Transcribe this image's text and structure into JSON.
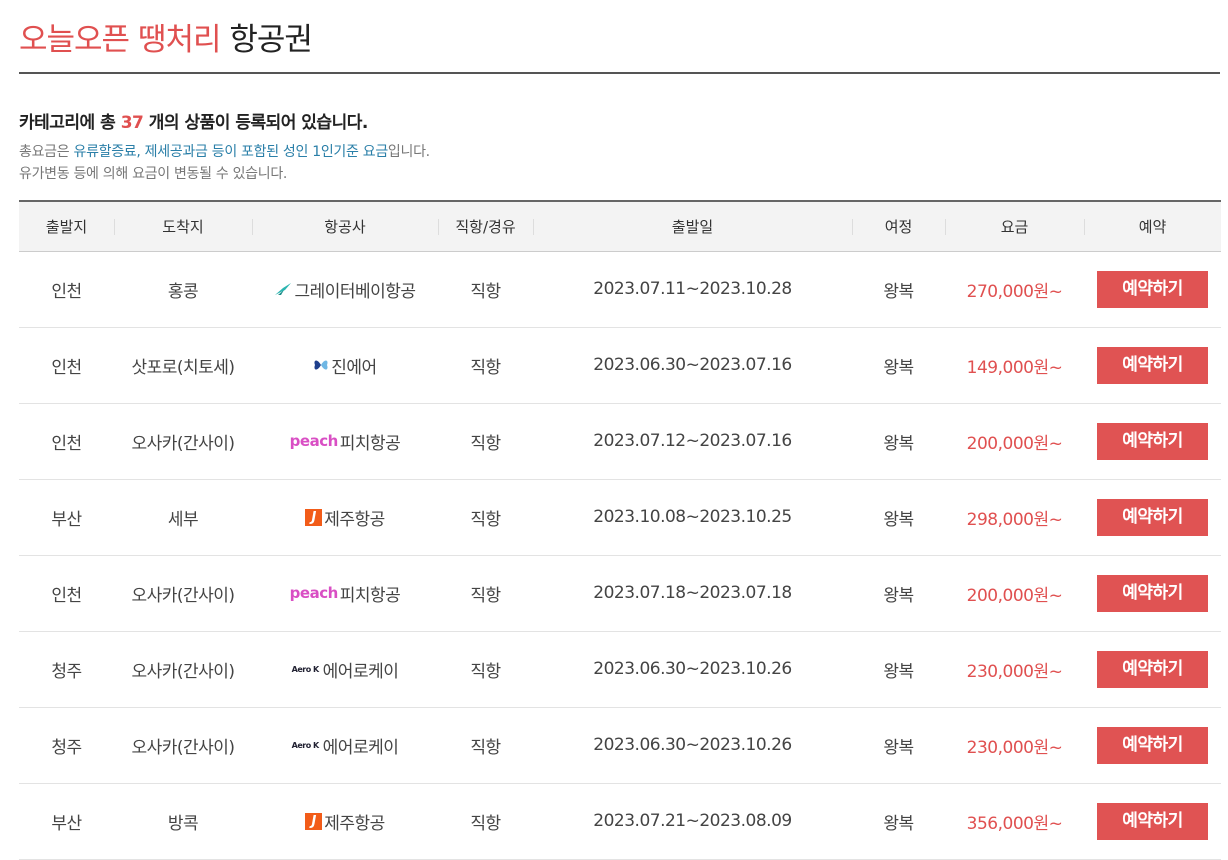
{
  "title": {
    "part1": "오늘오픈 땡처리",
    "part2": "항공권"
  },
  "summary": {
    "prefix": "카테고리에 총 ",
    "count": "37",
    "suffix": " 개의 상품이 등록되어 있습니다."
  },
  "notes": {
    "line1_prefix": "총요금은 ",
    "line1_highlight": "유류할증료, 제세공과금 등이 포함된 성인 1인기준 요금",
    "line1_suffix": "입니다.",
    "line2": "유가변동 등에 의해 요금이 변동될 수 있습니다."
  },
  "table": {
    "headers": [
      "출발지",
      "도착지",
      "항공사",
      "직항/경유",
      "출발일",
      "여정",
      "요금",
      "예약"
    ],
    "rows": [
      {
        "from": "인천",
        "to": "홍콩",
        "airline_logo": "greater-bay-logo",
        "airline": "그레이터베이항공",
        "route": "직항",
        "dates": "2023.07.11~2023.10.28",
        "trip": "왕복",
        "price": "270,000원~",
        "book": "예약하기"
      },
      {
        "from": "인천",
        "to": "삿포로(치토세)",
        "airline_logo": "jin-air-logo",
        "airline": "진에어",
        "route": "직항",
        "dates": "2023.06.30~2023.07.16",
        "trip": "왕복",
        "price": "149,000원~",
        "book": "예약하기"
      },
      {
        "from": "인천",
        "to": "오사카(간사이)",
        "airline_logo": "peach-logo",
        "logo_text": "peach",
        "airline": "피치항공",
        "route": "직항",
        "dates": "2023.07.12~2023.07.16",
        "trip": "왕복",
        "price": "200,000원~",
        "book": "예약하기"
      },
      {
        "from": "부산",
        "to": "세부",
        "airline_logo": "jeju-air-logo",
        "airline": "제주항공",
        "route": "직항",
        "dates": "2023.10.08~2023.10.25",
        "trip": "왕복",
        "price": "298,000원~",
        "book": "예약하기"
      },
      {
        "from": "인천",
        "to": "오사카(간사이)",
        "airline_logo": "peach-logo",
        "logo_text": "peach",
        "airline": "피치항공",
        "route": "직항",
        "dates": "2023.07.18~2023.07.18",
        "trip": "왕복",
        "price": "200,000원~",
        "book": "예약하기"
      },
      {
        "from": "청주",
        "to": "오사카(간사이)",
        "airline_logo": "aero-k-logo",
        "logo_text": "Aero K",
        "airline": "에어로케이",
        "route": "직항",
        "dates": "2023.06.30~2023.10.26",
        "trip": "왕복",
        "price": "230,000원~",
        "book": "예약하기"
      },
      {
        "from": "청주",
        "to": "오사카(간사이)",
        "airline_logo": "aero-k-logo",
        "logo_text": "Aero K",
        "airline": "에어로케이",
        "route": "직항",
        "dates": "2023.06.30~2023.10.26",
        "trip": "왕복",
        "price": "230,000원~",
        "book": "예약하기"
      },
      {
        "from": "부산",
        "to": "방콕",
        "airline_logo": "jeju-air-logo",
        "airline": "제주항공",
        "route": "직항",
        "dates": "2023.07.21~2023.08.09",
        "trip": "왕복",
        "price": "356,000원~",
        "book": "예약하기"
      }
    ]
  },
  "colors": {
    "accent": "#e05050",
    "button": "#e05353",
    "highlight": "#2a7fa8",
    "peach": "#d94fc4",
    "jeju": "#f25c19"
  }
}
